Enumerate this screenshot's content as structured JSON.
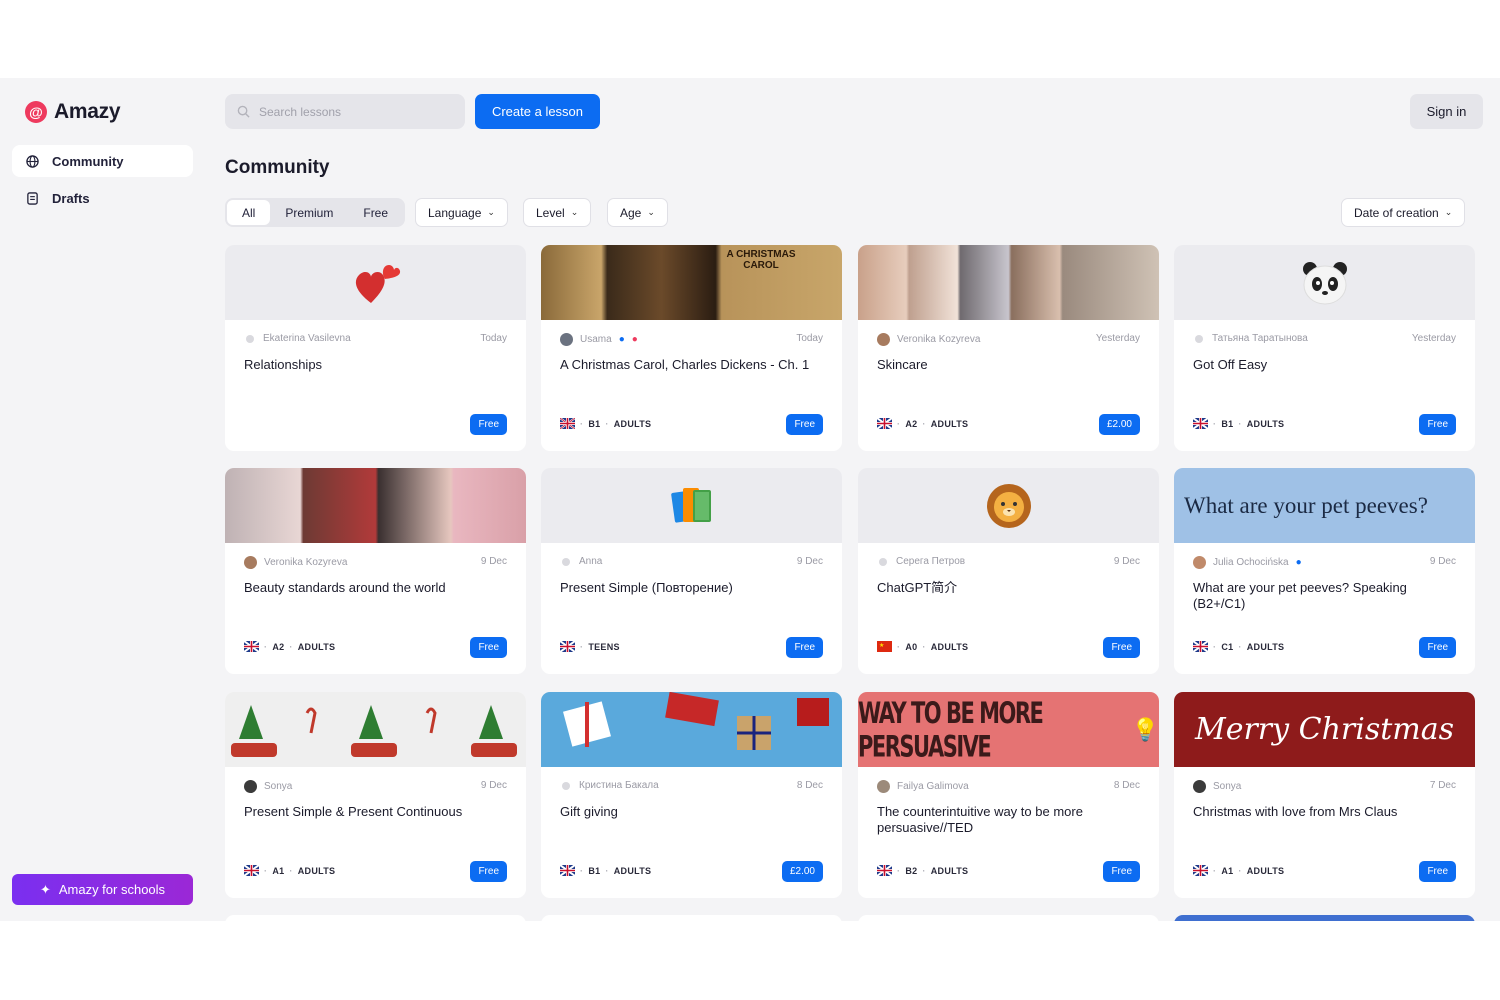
{
  "brand": {
    "name": "Amazy",
    "accent": "#ee3a5e"
  },
  "sidebar": {
    "items": [
      {
        "label": "Community",
        "icon": "globe-icon",
        "active": true
      },
      {
        "label": "Drafts",
        "icon": "document-icon",
        "active": false
      }
    ],
    "schools_button": "Amazy for schools"
  },
  "topbar": {
    "search_placeholder": "Search lessons",
    "create_label": "Create a lesson",
    "signin_label": "Sign in"
  },
  "page_title": "Community",
  "filters": {
    "segments": [
      "All",
      "Premium",
      "Free"
    ],
    "active_segment": "All",
    "language": "Language",
    "level": "Level",
    "age": "Age",
    "sort": "Date of creation"
  },
  "colors": {
    "primary": "#0c6cf2",
    "schools_gradient": "#7a2ff0"
  },
  "cards": [
    {
      "author": "Ekaterina Vasilevna",
      "date": "Today",
      "title": "Relationships",
      "flag": "",
      "level": "",
      "age": "",
      "price": "Free",
      "thumb": "heart-emoji"
    },
    {
      "author": "Usama",
      "date": "Today",
      "title": "A Christmas Carol, Charles Dickens - Ch. 1",
      "flag": "uk",
      "level": "B1",
      "age": "ADULTS",
      "price": "Free",
      "thumb": "christmas-carol-image",
      "thumb_text": "A CHRISTMAS CAROL"
    },
    {
      "author": "Veronika Kozyreva",
      "date": "Yesterday",
      "title": "Skincare",
      "flag": "uk",
      "level": "A2",
      "age": "ADULTS",
      "price": "£2.00",
      "thumb": "skincare-photos"
    },
    {
      "author": "Татьяна Таратынова",
      "date": "Yesterday",
      "title": "Got Off Easy",
      "flag": "uk",
      "level": "B1",
      "age": "ADULTS",
      "price": "Free",
      "thumb": "panda-emoji"
    },
    {
      "author": "Veronika Kozyreva",
      "date": "9 Dec",
      "title": "Beauty standards around the world",
      "flag": "uk",
      "level": "A2",
      "age": "ADULTS",
      "price": "Free",
      "thumb": "beauty-photos"
    },
    {
      "author": "Anna",
      "date": "9 Dec",
      "title": "Present Simple (Повторение)",
      "flag": "uk",
      "level": "",
      "age": "TEENS",
      "price": "Free",
      "thumb": "books-emoji"
    },
    {
      "author": "Серега Петров",
      "date": "9 Dec",
      "title": "ChatGPT简介",
      "flag": "cn",
      "level": "A0",
      "age": "ADULTS",
      "price": "Free",
      "thumb": "lion-emoji"
    },
    {
      "author": "Julia Ochocińska",
      "date": "9 Dec",
      "title": "What are your pet peeves? Speaking (B2+/C1)",
      "flag": "uk",
      "level": "C1",
      "age": "ADULTS",
      "price": "Free",
      "thumb": "pet-peeves-image",
      "thumb_text": "What are your pet peeves?"
    },
    {
      "author": "Sonya",
      "date": "9 Dec",
      "title": "Present Simple & Present Continuous",
      "flag": "uk",
      "level": "A1",
      "age": "ADULTS",
      "price": "Free",
      "thumb": "christmas-cars-pattern"
    },
    {
      "author": "Кристина Бакала",
      "date": "8 Dec",
      "title": "Gift giving",
      "flag": "uk",
      "level": "B1",
      "age": "ADULTS",
      "price": "£2.00",
      "thumb": "gifts-image"
    },
    {
      "author": "Failya Galimova",
      "date": "8 Dec",
      "title": "The counterintuitive way to be more persuasive//TED",
      "flag": "uk",
      "level": "B2",
      "age": "ADULTS",
      "price": "Free",
      "thumb": "persuasive-image",
      "thumb_text": "WAY TO BE MORE PERSUASIVE"
    },
    {
      "author": "Sonya",
      "date": "7 Dec",
      "title": "Christmas with love from Mrs Claus",
      "flag": "uk",
      "level": "A1",
      "age": "ADULTS",
      "price": "Free",
      "thumb": "merry-christmas-image",
      "thumb_text": "Merry Christmas"
    }
  ]
}
